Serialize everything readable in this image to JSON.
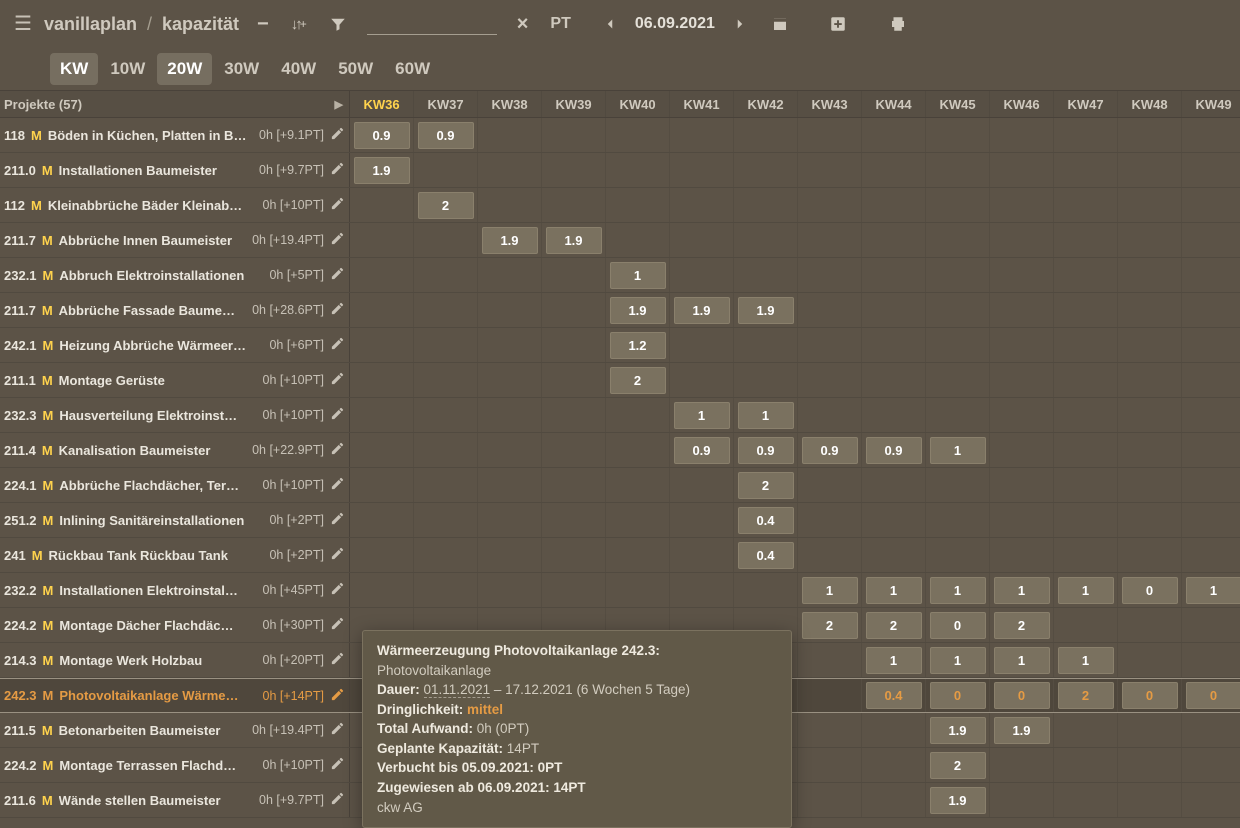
{
  "breadcrumbs": {
    "app": "vanillaplan",
    "page": "kapazität"
  },
  "toolbar": {
    "pt": "PT",
    "date": "06.09.2021"
  },
  "range_tabs": [
    "KW",
    "10W",
    "20W",
    "30W",
    "40W",
    "50W",
    "60W"
  ],
  "range_active": [
    "KW",
    "20W"
  ],
  "projects_header": "Projekte (57)",
  "weeks": [
    "KW36",
    "KW37",
    "KW38",
    "KW39",
    "KW40",
    "KW41",
    "KW42",
    "KW43",
    "KW44",
    "KW45",
    "KW46",
    "KW47",
    "KW48",
    "KW49"
  ],
  "current_week": "KW36",
  "rows": [
    {
      "code": "118",
      "m": "M",
      "name": "Böden in Küchen, Platten in B…",
      "info": "0h [+9.1PT]",
      "cells": {
        "KW36": "0.9",
        "KW37": "0.9"
      }
    },
    {
      "code": "211.0",
      "m": "M",
      "name": "Installationen Baumeister",
      "info": "0h [+9.7PT]",
      "cells": {
        "KW36": "1.9"
      }
    },
    {
      "code": "112",
      "m": "M",
      "name": "Kleinabbrüche Bäder Kleinab…",
      "info": "0h [+10PT]",
      "cells": {
        "KW37": "2"
      }
    },
    {
      "code": "211.7",
      "m": "M",
      "name": "Abbrüche Innen Baumeister",
      "info": "0h [+19.4PT]",
      "cells": {
        "KW38": "1.9",
        "KW39": "1.9"
      }
    },
    {
      "code": "232.1",
      "m": "M",
      "name": "Abbruch Elektroinstallationen",
      "info": "0h [+5PT]",
      "cells": {
        "KW40": "1"
      }
    },
    {
      "code": "211.7",
      "m": "M",
      "name": "Abbrüche Fassade Baume…",
      "info": "0h [+28.6PT]",
      "cells": {
        "KW40": "1.9",
        "KW41": "1.9",
        "KW42": "1.9"
      }
    },
    {
      "code": "242.1",
      "m": "M",
      "name": "Heizung Abbrüche Wärmeer…",
      "info": "0h [+6PT]",
      "cells": {
        "KW40": "1.2"
      }
    },
    {
      "code": "211.1",
      "m": "M",
      "name": "Montage Gerüste",
      "info": "0h [+10PT]",
      "cells": {
        "KW40": "2"
      }
    },
    {
      "code": "232.3",
      "m": "M",
      "name": "Hausverteilung Elektroinst…",
      "info": "0h [+10PT]",
      "cells": {
        "KW41": "1",
        "KW42": "1"
      }
    },
    {
      "code": "211.4",
      "m": "M",
      "name": "Kanalisation Baumeister",
      "info": "0h [+22.9PT]",
      "cells": {
        "KW41": "0.9",
        "KW42": "0.9",
        "KW43": "0.9",
        "KW44": "0.9",
        "KW45": "1"
      }
    },
    {
      "code": "224.1",
      "m": "M",
      "name": "Abbrüche Flachdächer, Ter…",
      "info": "0h [+10PT]",
      "cells": {
        "KW42": "2"
      }
    },
    {
      "code": "251.2",
      "m": "M",
      "name": "Inlining Sanitäreinstallationen",
      "info": "0h [+2PT]",
      "cells": {
        "KW42": "0.4"
      }
    },
    {
      "code": "241",
      "m": "M",
      "name": "Rückbau Tank Rückbau Tank",
      "info": "0h [+2PT]",
      "cells": {
        "KW42": "0.4"
      }
    },
    {
      "code": "232.2",
      "m": "M",
      "name": "Installationen Elektroinstal…",
      "info": "0h [+45PT]",
      "cells": {
        "KW43": "1",
        "KW44": "1",
        "KW45": "1",
        "KW46": "1",
        "KW47": "1",
        "KW48": "0",
        "KW49": "1"
      }
    },
    {
      "code": "224.2",
      "m": "M",
      "name": "Montage Dächer Flachdäc…",
      "info": "0h [+30PT]",
      "cells": {
        "KW43": "2",
        "KW44": "2",
        "KW45": "0",
        "KW46": "2"
      }
    },
    {
      "code": "214.3",
      "m": "M",
      "name": "Montage Werk Holzbau",
      "info": "0h [+20PT]",
      "cells": {
        "KW44": "1",
        "KW45": "1",
        "KW46": "1",
        "KW47": "1"
      }
    },
    {
      "code": "242.3",
      "m": "M",
      "name": "Photovoltaikanlage Wärme…",
      "info": "0h [+14PT]",
      "active": true,
      "cells": {
        "KW44": "0.4",
        "KW45": "0",
        "KW46": "0",
        "KW47": "2",
        "KW48": "0",
        "KW49": "0"
      }
    },
    {
      "code": "211.5",
      "m": "M",
      "name": "Betonarbeiten Baumeister",
      "info": "0h [+19.4PT]",
      "cells": {
        "KW45": "1.9",
        "KW46": "1.9"
      }
    },
    {
      "code": "224.2",
      "m": "M",
      "name": "Montage Terrassen Flachd…",
      "info": "0h [+10PT]",
      "cells": {
        "KW45": "2"
      }
    },
    {
      "code": "211.6",
      "m": "M",
      "name": "Wände stellen Baumeister",
      "info": "0h [+9.7PT]",
      "cells": {
        "KW45": "1.9"
      }
    }
  ],
  "tooltip": {
    "title_prefix": "Wärmeerzeugung Photovoltaikanlage 242.3:",
    "title_suffix": "Photovoltaikanlage",
    "dauer_label": "Dauer:",
    "dauer_start": "01.11.2021",
    "dauer_sep": " – ",
    "dauer_end": "17.12.2021 (6 Wochen 5 Tage)",
    "dring_label": "Dringlichkeit:",
    "dring_value": "mittel",
    "aufwand": "Total Aufwand:",
    "aufwand_v": "0h (0PT)",
    "kapazitaet": "Geplante Kapazität:",
    "kapazitaet_v": "14PT",
    "verbucht": "Verbucht bis 05.09.2021: 0PT",
    "zugewiesen": "Zugewiesen ab 06.09.2021: 14PT",
    "org": "ckw AG"
  }
}
